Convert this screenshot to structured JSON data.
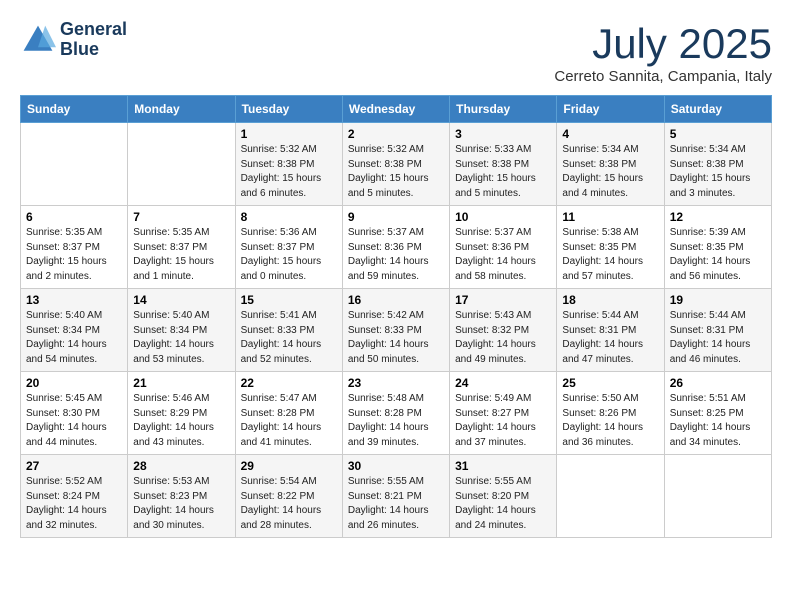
{
  "header": {
    "logo_line1": "General",
    "logo_line2": "Blue",
    "month": "July 2025",
    "location": "Cerreto Sannita, Campania, Italy"
  },
  "weekdays": [
    "Sunday",
    "Monday",
    "Tuesday",
    "Wednesday",
    "Thursday",
    "Friday",
    "Saturday"
  ],
  "weeks": [
    [
      {
        "day": "",
        "info": ""
      },
      {
        "day": "",
        "info": ""
      },
      {
        "day": "1",
        "info": "Sunrise: 5:32 AM\nSunset: 8:38 PM\nDaylight: 15 hours\nand 6 minutes."
      },
      {
        "day": "2",
        "info": "Sunrise: 5:32 AM\nSunset: 8:38 PM\nDaylight: 15 hours\nand 5 minutes."
      },
      {
        "day": "3",
        "info": "Sunrise: 5:33 AM\nSunset: 8:38 PM\nDaylight: 15 hours\nand 5 minutes."
      },
      {
        "day": "4",
        "info": "Sunrise: 5:34 AM\nSunset: 8:38 PM\nDaylight: 15 hours\nand 4 minutes."
      },
      {
        "day": "5",
        "info": "Sunrise: 5:34 AM\nSunset: 8:38 PM\nDaylight: 15 hours\nand 3 minutes."
      }
    ],
    [
      {
        "day": "6",
        "info": "Sunrise: 5:35 AM\nSunset: 8:37 PM\nDaylight: 15 hours\nand 2 minutes."
      },
      {
        "day": "7",
        "info": "Sunrise: 5:35 AM\nSunset: 8:37 PM\nDaylight: 15 hours\nand 1 minute."
      },
      {
        "day": "8",
        "info": "Sunrise: 5:36 AM\nSunset: 8:37 PM\nDaylight: 15 hours\nand 0 minutes."
      },
      {
        "day": "9",
        "info": "Sunrise: 5:37 AM\nSunset: 8:36 PM\nDaylight: 14 hours\nand 59 minutes."
      },
      {
        "day": "10",
        "info": "Sunrise: 5:37 AM\nSunset: 8:36 PM\nDaylight: 14 hours\nand 58 minutes."
      },
      {
        "day": "11",
        "info": "Sunrise: 5:38 AM\nSunset: 8:35 PM\nDaylight: 14 hours\nand 57 minutes."
      },
      {
        "day": "12",
        "info": "Sunrise: 5:39 AM\nSunset: 8:35 PM\nDaylight: 14 hours\nand 56 minutes."
      }
    ],
    [
      {
        "day": "13",
        "info": "Sunrise: 5:40 AM\nSunset: 8:34 PM\nDaylight: 14 hours\nand 54 minutes."
      },
      {
        "day": "14",
        "info": "Sunrise: 5:40 AM\nSunset: 8:34 PM\nDaylight: 14 hours\nand 53 minutes."
      },
      {
        "day": "15",
        "info": "Sunrise: 5:41 AM\nSunset: 8:33 PM\nDaylight: 14 hours\nand 52 minutes."
      },
      {
        "day": "16",
        "info": "Sunrise: 5:42 AM\nSunset: 8:33 PM\nDaylight: 14 hours\nand 50 minutes."
      },
      {
        "day": "17",
        "info": "Sunrise: 5:43 AM\nSunset: 8:32 PM\nDaylight: 14 hours\nand 49 minutes."
      },
      {
        "day": "18",
        "info": "Sunrise: 5:44 AM\nSunset: 8:31 PM\nDaylight: 14 hours\nand 47 minutes."
      },
      {
        "day": "19",
        "info": "Sunrise: 5:44 AM\nSunset: 8:31 PM\nDaylight: 14 hours\nand 46 minutes."
      }
    ],
    [
      {
        "day": "20",
        "info": "Sunrise: 5:45 AM\nSunset: 8:30 PM\nDaylight: 14 hours\nand 44 minutes."
      },
      {
        "day": "21",
        "info": "Sunrise: 5:46 AM\nSunset: 8:29 PM\nDaylight: 14 hours\nand 43 minutes."
      },
      {
        "day": "22",
        "info": "Sunrise: 5:47 AM\nSunset: 8:28 PM\nDaylight: 14 hours\nand 41 minutes."
      },
      {
        "day": "23",
        "info": "Sunrise: 5:48 AM\nSunset: 8:28 PM\nDaylight: 14 hours\nand 39 minutes."
      },
      {
        "day": "24",
        "info": "Sunrise: 5:49 AM\nSunset: 8:27 PM\nDaylight: 14 hours\nand 37 minutes."
      },
      {
        "day": "25",
        "info": "Sunrise: 5:50 AM\nSunset: 8:26 PM\nDaylight: 14 hours\nand 36 minutes."
      },
      {
        "day": "26",
        "info": "Sunrise: 5:51 AM\nSunset: 8:25 PM\nDaylight: 14 hours\nand 34 minutes."
      }
    ],
    [
      {
        "day": "27",
        "info": "Sunrise: 5:52 AM\nSunset: 8:24 PM\nDaylight: 14 hours\nand 32 minutes."
      },
      {
        "day": "28",
        "info": "Sunrise: 5:53 AM\nSunset: 8:23 PM\nDaylight: 14 hours\nand 30 minutes."
      },
      {
        "day": "29",
        "info": "Sunrise: 5:54 AM\nSunset: 8:22 PM\nDaylight: 14 hours\nand 28 minutes."
      },
      {
        "day": "30",
        "info": "Sunrise: 5:55 AM\nSunset: 8:21 PM\nDaylight: 14 hours\nand 26 minutes."
      },
      {
        "day": "31",
        "info": "Sunrise: 5:55 AM\nSunset: 8:20 PM\nDaylight: 14 hours\nand 24 minutes."
      },
      {
        "day": "",
        "info": ""
      },
      {
        "day": "",
        "info": ""
      }
    ]
  ]
}
